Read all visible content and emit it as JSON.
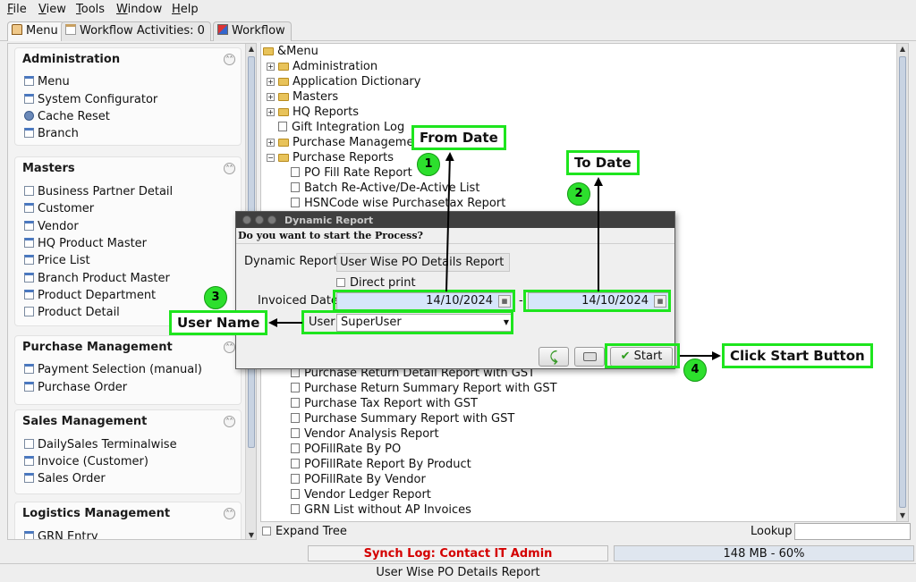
{
  "menubar": {
    "items": [
      "File",
      "View",
      "Tools",
      "Window",
      "Help"
    ]
  },
  "tabs": [
    {
      "label": "Menu",
      "icon": "house-icon",
      "active": true
    },
    {
      "label": "Workflow Activities: 0",
      "icon": "list-icon",
      "active": false
    },
    {
      "label": "Workflow",
      "icon": "workflow-icon",
      "active": false
    }
  ],
  "sidebar": {
    "sections": [
      {
        "title": "Administration",
        "items": [
          "Menu",
          "System Configurator",
          "Cache Reset",
          "Branch"
        ]
      },
      {
        "title": "Masters",
        "items": [
          "Business Partner Detail",
          "Customer",
          "Vendor",
          "HQ Product Master",
          "Price List",
          "Branch Product Master",
          "Product Department",
          "Product Detail"
        ]
      },
      {
        "title": "Purchase Management",
        "items": [
          "Payment Selection (manual)",
          "Purchase Order"
        ]
      },
      {
        "title": "Sales Management",
        "items": [
          "DailySales Terminalwise",
          "Invoice (Customer)",
          "Sales Order"
        ]
      },
      {
        "title": "Logistics Management",
        "items": [
          "GRN Entry"
        ]
      }
    ]
  },
  "tree": {
    "root": "&Menu",
    "top_items": [
      {
        "label": "Administration",
        "type": "folder",
        "expanded": false
      },
      {
        "label": "Application Dictionary",
        "type": "folder",
        "expanded": false
      },
      {
        "label": "Masters",
        "type": "folder",
        "expanded": false
      },
      {
        "label": "HQ Reports",
        "type": "folder",
        "expanded": false
      },
      {
        "label": "Gift Integration Log",
        "type": "leaf"
      },
      {
        "label": "Purchase Management",
        "type": "folder",
        "expanded": false
      },
      {
        "label": "Purchase Reports",
        "type": "folder",
        "expanded": true
      },
      {
        "label": "PO Fill Rate Report",
        "type": "child"
      },
      {
        "label": "Batch Re-Active/De-Active List",
        "type": "child"
      },
      {
        "label": "HSNCode wise Purchasetax Report",
        "type": "child"
      }
    ],
    "lower_items": [
      "Purchase Return Detail Report with GST",
      "Purchase Return Summary Report with GST",
      "Purchase Tax Report with GST",
      "Purchase Summary Report with GST",
      "Vendor Analysis Report",
      "POFillRate By PO",
      "POFillRate Report By Product",
      "POFillRate By Vendor",
      "Vendor Ledger Report",
      "GRN List without AP Invoices"
    ]
  },
  "bottom": {
    "expand_tree_label": "Expand Tree",
    "lookup_label": "Lookup",
    "lookup_value": ""
  },
  "status": {
    "synch_log": "Synch Log: Contact IT Admin",
    "memory": "148 MB - 60%",
    "footer": "User Wise PO Details Report"
  },
  "dialog": {
    "title": "Dynamic Report",
    "prompt": "Do you want to start the Process?",
    "report_label": "Dynamic Report",
    "report_value": "User Wise PO Details Report",
    "direct_print_label": "Direct print",
    "invoiced_date_label": "Invoiced Date",
    "date_from": "14/10/2024",
    "date_separator": "-",
    "date_to": "14/10/2024",
    "user_label": "User",
    "user_value": "SuperUser",
    "start_label": "Start"
  },
  "annotations": {
    "from_date": "From Date",
    "to_date": "To Date",
    "user_name": "User Name",
    "click_start": "Click Start Button",
    "badges": [
      "1",
      "2",
      "3",
      "4"
    ]
  },
  "colors": {
    "highlight": "#1ee51e",
    "synch_log_text": "#d40000",
    "dialog_titlebar": "#3f3f3f",
    "date_field_bg": "#d6e6fb"
  }
}
